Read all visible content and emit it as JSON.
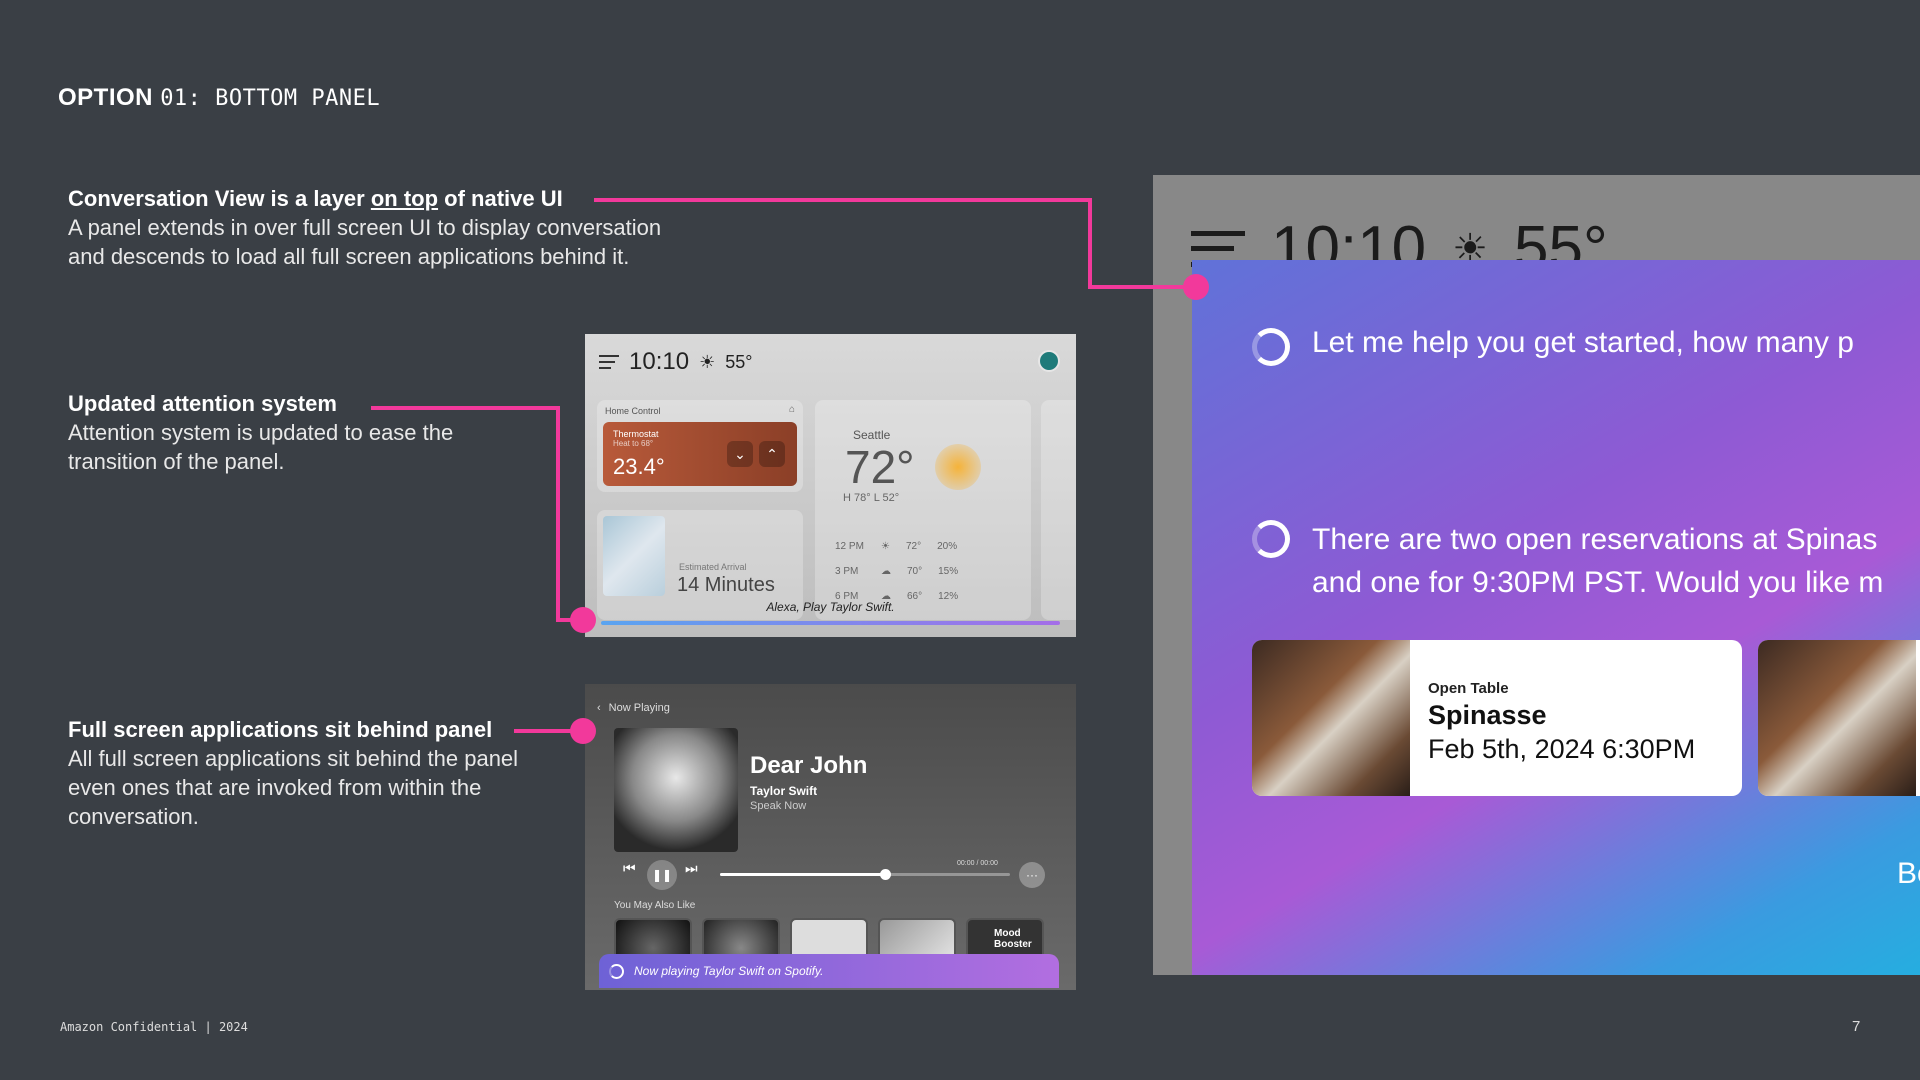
{
  "title": {
    "strong": "OPTION",
    "rest": "01: BOTTOM PANEL"
  },
  "annotations": [
    {
      "heading_pre": "Conversation View is a layer ",
      "heading_ul": "on top",
      "heading_post": " of native UI",
      "body": "A panel extends in over full screen UI to display conversation and descends to load all full screen applications behind it."
    },
    {
      "heading": "Updated attention system",
      "body": "Attention system is updated to ease the transition of the panel."
    },
    {
      "heading": "Full screen applications sit behind panel",
      "body": "All full screen applications sit behind the panel even ones that are invoked from within the conversation."
    }
  ],
  "colors": {
    "accent": "#f2399b",
    "background": "#3a3f45"
  },
  "home_mock": {
    "time": "10:10",
    "temp": "55°",
    "icons": [
      "menu-icon",
      "sun-icon",
      "avatar-icon",
      "home-icon",
      "chevron-down-icon",
      "chevron-up-icon"
    ],
    "home_control": "Home Control",
    "thermostat_label": "Thermostat",
    "thermostat_sub": "Heat to 68°",
    "thermostat_value": "23.4°",
    "estimated_arrival": "Estimated Arrival",
    "arrival_value": "14 Minutes",
    "weather_city": "Seattle",
    "weather_temp": "72°",
    "weather_hl": "H 78°  L 52°",
    "forecast": [
      {
        "time": "12 PM",
        "temp": "72°",
        "precip": "20%"
      },
      {
        "time": "3 PM",
        "temp": "70°",
        "precip": "15%"
      },
      {
        "time": "6 PM",
        "temp": "66°",
        "precip": "12%"
      }
    ],
    "prompt": "Alexa, Play Taylor Swift."
  },
  "player_mock": {
    "header": "Now Playing",
    "song": "Dear John",
    "artist": "Taylor Swift",
    "album": "Speak Now",
    "duration": "00:00 / 00:00",
    "progress": 0.57,
    "you_may_also_like": "You May Also Like",
    "mood_booster": "Mood Booster",
    "toast": "Now playing Taylor Swift on Spotify."
  },
  "device": {
    "time": "10:10",
    "temp": "55°",
    "msg1": "Let me help you get started, how many p",
    "msg2_line1": "There are two open reservations at Spinas",
    "msg2_line2": "and one for 9:30PM PST. Would you like m",
    "reservation": {
      "source": "Open Table",
      "name": "Spinasse",
      "date": "Feb 5th, 2024 6:30PM"
    },
    "button_partial": "Bo"
  },
  "footer": "Amazon Confidential | 2024",
  "page_number": "7"
}
